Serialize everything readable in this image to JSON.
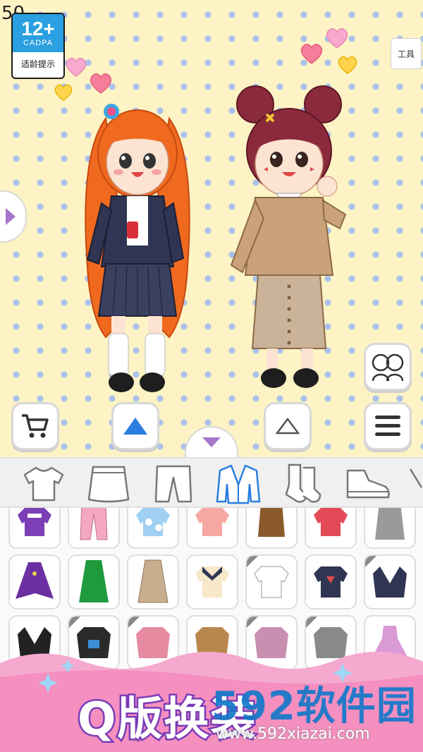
{
  "status": {
    "clock_fragment": "50"
  },
  "age_rating": {
    "age": "12+",
    "org": "CADPA",
    "hint": "适龄提示"
  },
  "toolbar": {
    "tools_label": "工具"
  },
  "categories": [
    {
      "icon": "tshirt-icon",
      "active": false
    },
    {
      "icon": "skirt-icon",
      "active": false
    },
    {
      "icon": "pants-icon",
      "active": false
    },
    {
      "icon": "jacket-icon",
      "active": true
    },
    {
      "icon": "socks-icon",
      "active": false
    },
    {
      "icon": "shoe-icon",
      "active": false
    }
  ],
  "colors": {
    "accent_blue": "#2a7de1",
    "accent_purple": "#a775c9",
    "background": "#fdf3c4",
    "dots": "#a9c2ec"
  },
  "banner": {
    "title": "Q版换装"
  },
  "watermark": {
    "brand": "592软件园",
    "url": "www.592xiazai.com"
  }
}
